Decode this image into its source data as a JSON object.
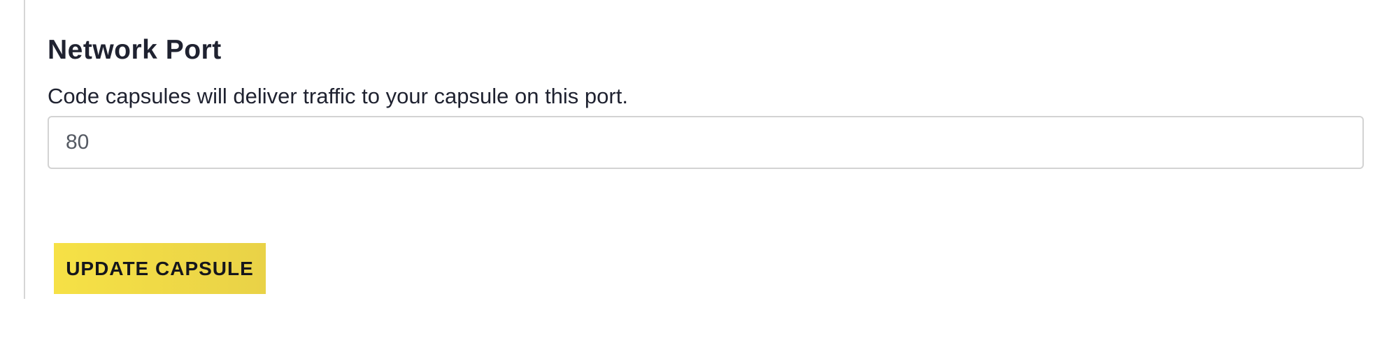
{
  "network_port": {
    "title": "Network Port",
    "description": "Code capsules will deliver traffic to your capsule on this port.",
    "port_value": "80"
  },
  "actions": {
    "update_label": "UPDATE CAPSULE"
  },
  "colors": {
    "accent": "#f3dd45",
    "text": "#1f2230",
    "border": "#d3d3d3"
  }
}
